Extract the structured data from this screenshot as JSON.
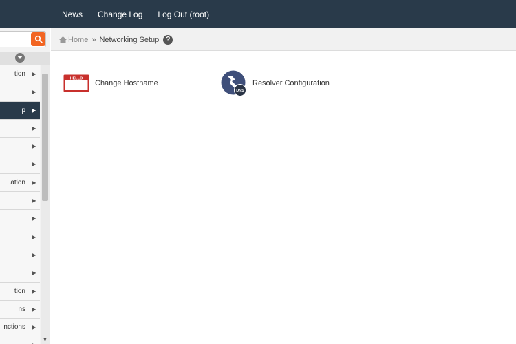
{
  "topnav": {
    "items": [
      "News",
      "Change Log",
      "Log Out (root)"
    ]
  },
  "sidebar": {
    "menu": [
      {
        "label": "tion",
        "active": false
      },
      {
        "label": "",
        "active": false
      },
      {
        "label": "p",
        "active": true
      },
      {
        "label": "",
        "active": false
      },
      {
        "label": "",
        "active": false
      },
      {
        "label": "",
        "active": false
      },
      {
        "label": "ation",
        "active": false
      },
      {
        "label": "",
        "active": false
      },
      {
        "label": "",
        "active": false
      },
      {
        "label": "",
        "active": false
      },
      {
        "label": "",
        "active": false
      },
      {
        "label": "",
        "active": false
      },
      {
        "label": "tion",
        "active": false
      },
      {
        "label": "ns",
        "active": false
      },
      {
        "label": "nctions",
        "active": false
      },
      {
        "label": "",
        "active": false
      }
    ]
  },
  "breadcrumb": {
    "home": "Home",
    "separator": "»",
    "current": "Networking Setup",
    "help": "?"
  },
  "features": {
    "hostname": {
      "label": "Change Hostname",
      "icon_text": "HELLO"
    },
    "resolver": {
      "label": "Resolver Configuration",
      "icon_text": "DNS"
    }
  },
  "colors": {
    "topbar": "#293a4a",
    "search_button": "#f26522",
    "hostname_icon": "#c8302c",
    "resolver_icon": "#3f4f7a"
  }
}
